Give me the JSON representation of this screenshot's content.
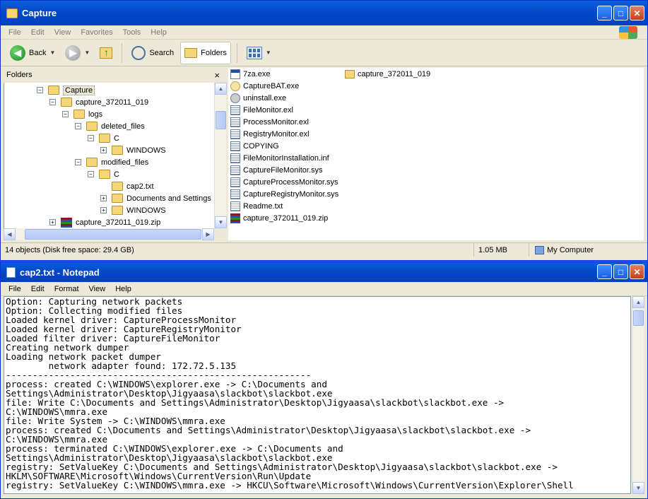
{
  "explorer": {
    "title": "Capture",
    "menu": [
      "File",
      "Edit",
      "View",
      "Favorites",
      "Tools",
      "Help"
    ],
    "toolbar": {
      "back": "Back",
      "search": "Search",
      "folders": "Folders"
    },
    "folders_pane": {
      "title": "Folders",
      "close": "×",
      "tree": [
        {
          "label": "Capture",
          "exp": "−",
          "level": 0
        },
        {
          "label": "capture_372011_019",
          "exp": "−",
          "level": 1
        },
        {
          "label": "logs",
          "exp": "−",
          "level": 2
        },
        {
          "label": "deleted_files",
          "exp": "−",
          "level": 3
        },
        {
          "label": "C",
          "exp": "−",
          "level": 4
        },
        {
          "label": "WINDOWS",
          "exp": "+",
          "level": 5
        },
        {
          "label": "modified_files",
          "exp": "−",
          "level": 3
        },
        {
          "label": "C",
          "exp": "−",
          "level": 4
        },
        {
          "label": "cap2.txt",
          "exp": "",
          "level": 5
        },
        {
          "label": "Documents and Settings",
          "exp": "+",
          "level": 5
        },
        {
          "label": "WINDOWS",
          "exp": "+",
          "level": 5
        },
        {
          "label": "capture_372011_019.zip",
          "exp": "+",
          "level": 1
        }
      ]
    },
    "files_col1": [
      {
        "name": "7za.exe",
        "icon": "exe"
      },
      {
        "name": "CaptureBAT.exe",
        "icon": "bat"
      },
      {
        "name": "uninstall.exe",
        "icon": "un"
      },
      {
        "name": "FileMonitor.exl",
        "icon": "cfg"
      },
      {
        "name": "ProcessMonitor.exl",
        "icon": "cfg"
      },
      {
        "name": "RegistryMonitor.exl",
        "icon": "cfg"
      },
      {
        "name": "COPYING",
        "icon": "cfg"
      },
      {
        "name": "FileMonitorInstallation.inf",
        "icon": "cfg"
      },
      {
        "name": "CaptureFileMonitor.sys",
        "icon": "cfg"
      },
      {
        "name": "CaptureProcessMonitor.sys",
        "icon": "cfg"
      },
      {
        "name": "CaptureRegistryMonitor.sys",
        "icon": "cfg"
      },
      {
        "name": "Readme.txt",
        "icon": "txt"
      },
      {
        "name": "capture_372011_019.zip",
        "icon": "zip"
      }
    ],
    "files_col2": [
      {
        "name": "capture_372011_019",
        "icon": "fold"
      }
    ],
    "status": {
      "objects": "14 objects (Disk free space: 29.4 GB)",
      "size": "1.05 MB",
      "location": "My Computer"
    }
  },
  "notepad": {
    "title": "cap2.txt - Notepad",
    "menu": [
      "File",
      "Edit",
      "Format",
      "View",
      "Help"
    ],
    "lines": [
      "Option: Capturing network packets",
      "Option: Collecting modified files",
      "Loaded kernel driver: CaptureProcessMonitor",
      "Loaded kernel driver: CaptureRegistryMonitor",
      "Loaded filter driver: CaptureFileMonitor",
      "Creating network dumper",
      "Loading network packet dumper",
      "        network adapter found: 172.72.5.135",
      "---------------------------------------------------------",
      "process: created C:\\WINDOWS\\explorer.exe -> C:\\Documents and",
      "Settings\\Administrator\\Desktop\\Jigyaasa\\slackbot\\slackbot.exe",
      "file: Write C:\\Documents and Settings\\Administrator\\Desktop\\Jigyaasa\\slackbot\\slackbot.exe ->",
      "C:\\WINDOWS\\mmra.exe",
      "file: Write System -> C:\\WINDOWS\\mmra.exe",
      "process: created C:\\Documents and Settings\\Administrator\\Desktop\\Jigyaasa\\slackbot\\slackbot.exe ->",
      "C:\\WINDOWS\\mmra.exe",
      "process: terminated C:\\WINDOWS\\explorer.exe -> C:\\Documents and",
      "Settings\\Administrator\\Desktop\\Jigyaasa\\slackbot\\slackbot.exe",
      "registry: SetValueKey C:\\Documents and Settings\\Administrator\\Desktop\\Jigyaasa\\slackbot\\slackbot.exe ->",
      "HKLM\\SOFTWARE\\Microsoft\\Windows\\CurrentVersion\\Run\\Update",
      "registry: SetValueKey C:\\WINDOWS\\mmra.exe -> HKCU\\Software\\Microsoft\\Windows\\CurrentVersion\\Explorer\\Shell"
    ]
  }
}
